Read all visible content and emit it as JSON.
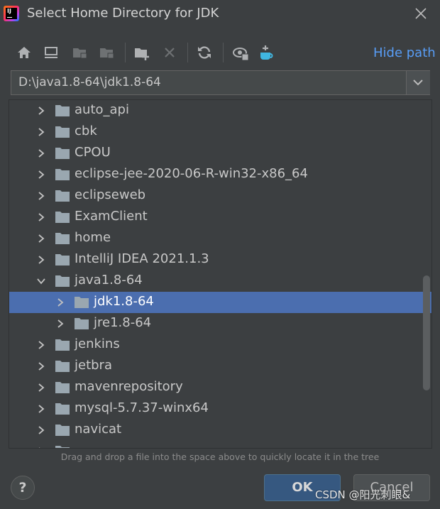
{
  "window": {
    "title": "Select Home Directory for JDK",
    "logo_text": "IJ"
  },
  "toolbar": {
    "icons": [
      "home-icon",
      "desktop-icon",
      "project-icon",
      "module-icon",
      "new-folder-icon",
      "delete-icon",
      "refresh-icon",
      "show-hidden-icon",
      "jdk-icon"
    ],
    "hide_path_label": "Hide path"
  },
  "path": {
    "value": "D:\\java1.8-64\\jdk1.8-64"
  },
  "tree": {
    "items": [
      {
        "label": "auto_api",
        "level": 0,
        "expanded": false,
        "selected": false
      },
      {
        "label": "cbk",
        "level": 0,
        "expanded": false,
        "selected": false
      },
      {
        "label": "CPOU",
        "level": 0,
        "expanded": false,
        "selected": false
      },
      {
        "label": "eclipse-jee-2020-06-R-win32-x86_64",
        "level": 0,
        "expanded": false,
        "selected": false
      },
      {
        "label": "eclipseweb",
        "level": 0,
        "expanded": false,
        "selected": false
      },
      {
        "label": "ExamClient",
        "level": 0,
        "expanded": false,
        "selected": false
      },
      {
        "label": "home",
        "level": 0,
        "expanded": false,
        "selected": false
      },
      {
        "label": "IntelliJ IDEA 2021.1.3",
        "level": 0,
        "expanded": false,
        "selected": false
      },
      {
        "label": "java1.8-64",
        "level": 0,
        "expanded": true,
        "selected": false
      },
      {
        "label": "jdk1.8-64",
        "level": 1,
        "expanded": false,
        "selected": true
      },
      {
        "label": "jre1.8-64",
        "level": 1,
        "expanded": false,
        "selected": false
      },
      {
        "label": "jenkins",
        "level": 0,
        "expanded": false,
        "selected": false
      },
      {
        "label": "jetbra",
        "level": 0,
        "expanded": false,
        "selected": false
      },
      {
        "label": "mavenrepository",
        "level": 0,
        "expanded": false,
        "selected": false
      },
      {
        "label": "mysql-5.7.37-winx64",
        "level": 0,
        "expanded": false,
        "selected": false
      },
      {
        "label": "navicat",
        "level": 0,
        "expanded": false,
        "selected": false
      },
      {
        "label": "",
        "level": 0,
        "expanded": false,
        "selected": false
      }
    ]
  },
  "hint": "Drag and drop a file into the space above to quickly locate it in the tree",
  "buttons": {
    "help": "?",
    "ok": "OK",
    "cancel": "Cancel"
  },
  "watermark": "CSDN @阳光刺眼&",
  "colors": {
    "background": "#3c3f41",
    "selection": "#4b6eaf",
    "link": "#589df6",
    "folder": "#9aa7b0",
    "ok_button": "#365880"
  }
}
